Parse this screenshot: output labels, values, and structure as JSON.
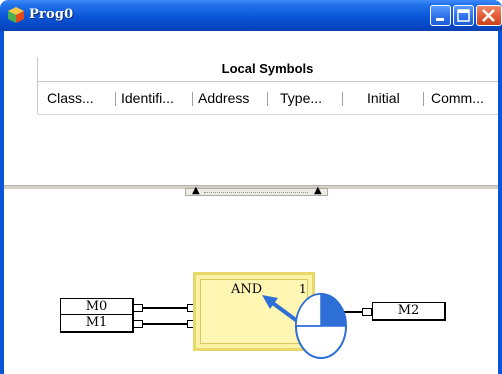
{
  "window": {
    "title": "Prog0",
    "icon": "program-icon"
  },
  "local_symbols": {
    "title": "Local Symbols",
    "columns": [
      "Class...",
      "Identifi...",
      "Address",
      "Type...",
      "Initial",
      "Comm..."
    ]
  },
  "diagram": {
    "inputs": [
      "M0",
      "M1"
    ],
    "function_block": {
      "name": "AND",
      "instance": "1"
    },
    "output": "M2"
  },
  "colors": {
    "titlebar": "#0a55d8",
    "block_fill": "#fff6b3",
    "block_border": "#e8d86a",
    "pointer": "#2d6fd6"
  }
}
